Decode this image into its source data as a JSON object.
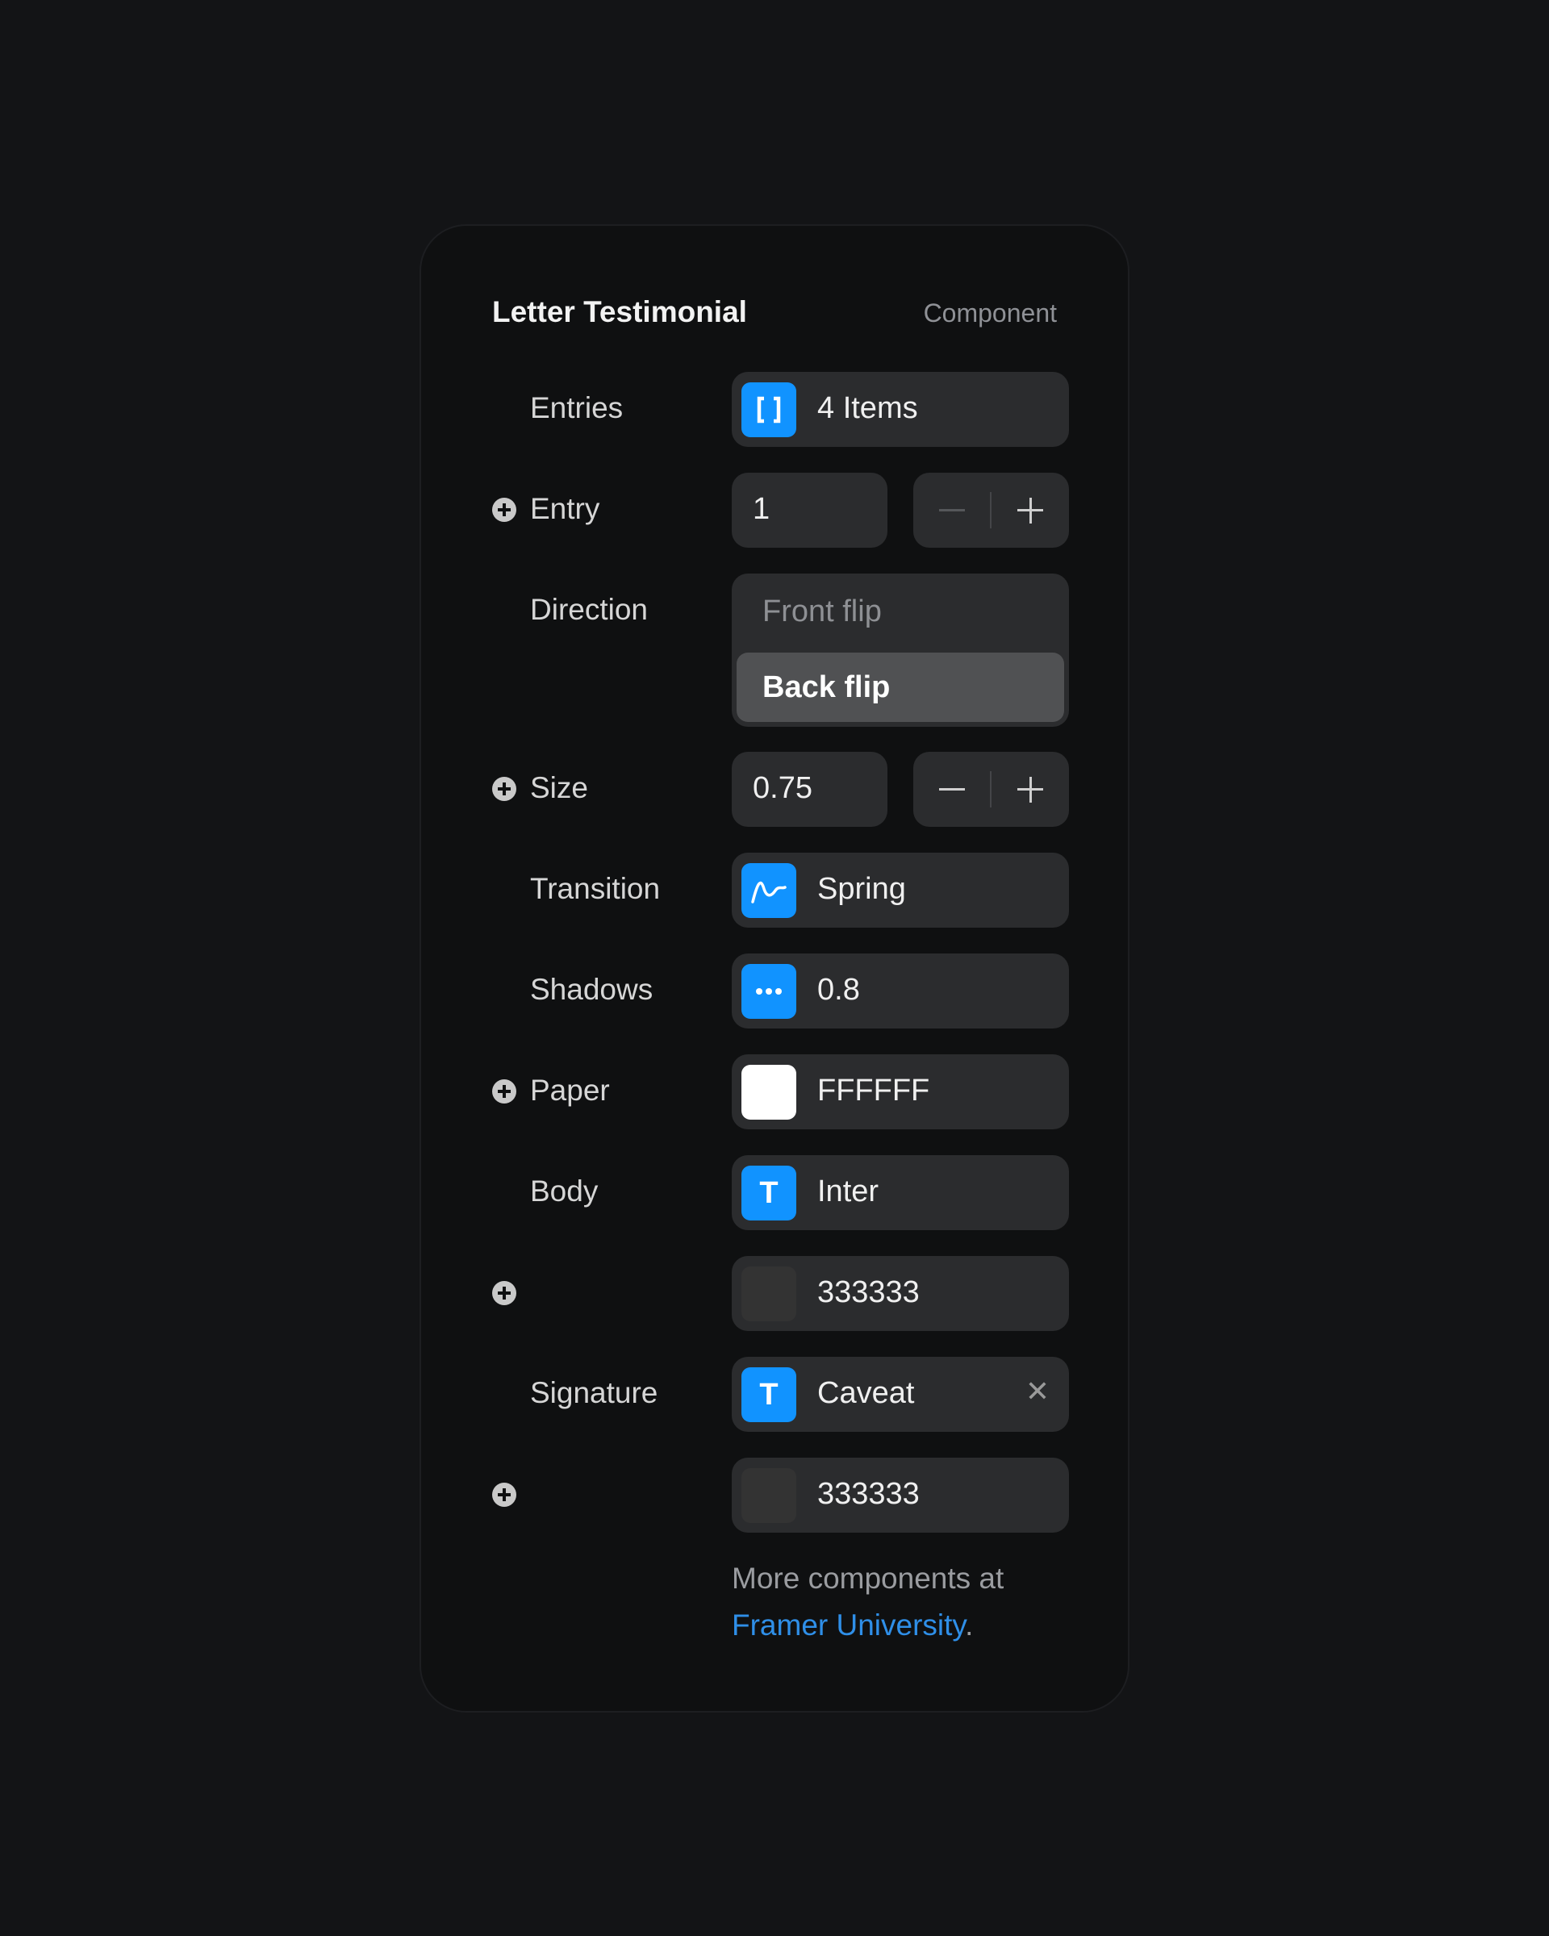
{
  "panel": {
    "title": "Letter Testimonial",
    "kind": "Component"
  },
  "rows": {
    "entries": {
      "label": "Entries",
      "value": "4 Items",
      "icon": "array-brackets-icon"
    },
    "entry": {
      "label": "Entry",
      "value": "1"
    },
    "direction": {
      "label": "Direction",
      "options": [
        "Front flip",
        "Back flip"
      ],
      "selected": "Back flip"
    },
    "size": {
      "label": "Size",
      "value": "0.75"
    },
    "transition": {
      "label": "Transition",
      "value": "Spring",
      "icon": "spring-curve-icon"
    },
    "shadows": {
      "label": "Shadows",
      "value": "0.8",
      "icon": "ellipsis-icon"
    },
    "paper": {
      "label": "Paper",
      "value": "FFFFFF",
      "swatch": "#FFFFFF"
    },
    "body": {
      "label": "Body",
      "value": "Inter",
      "icon": "text-t-icon"
    },
    "body_color": {
      "value": "333333",
      "swatch": "#333333"
    },
    "signature": {
      "label": "Signature",
      "value": "Caveat",
      "icon": "text-t-icon",
      "clear": "✕"
    },
    "signature_color": {
      "value": "333333",
      "swatch": "#333333"
    }
  },
  "footer": {
    "text": "More components at",
    "link": "Framer University",
    "suffix": "."
  },
  "colors": {
    "accent": "#1193FF",
    "link": "#2F8FE8"
  }
}
